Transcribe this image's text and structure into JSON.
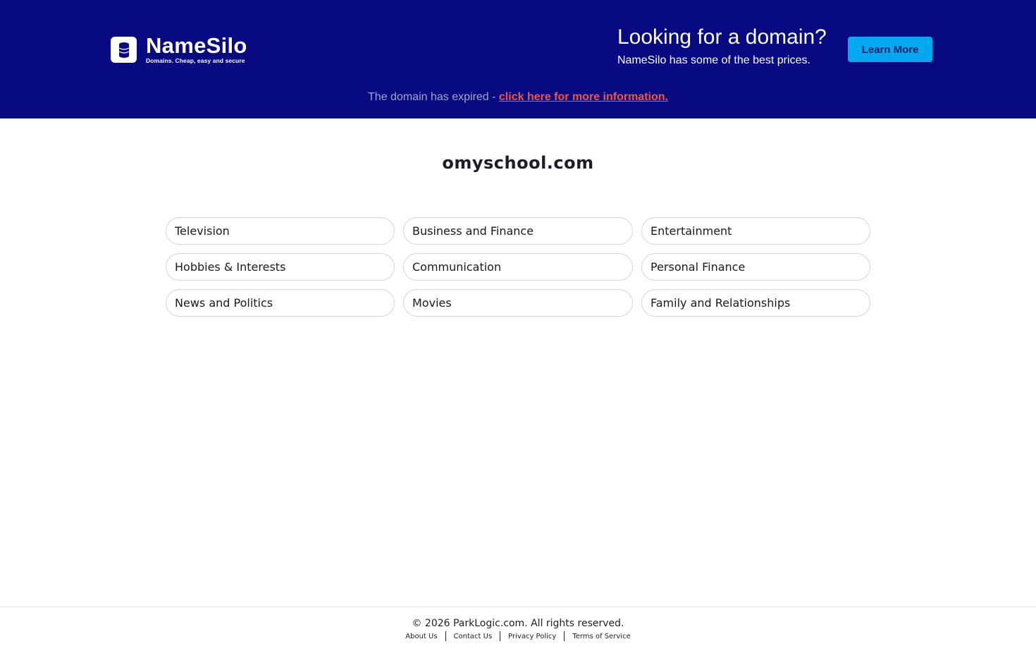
{
  "header": {
    "logo": {
      "name": "NameSilo",
      "tagline": "Domains. Cheap, easy and secure",
      "icon": "database-icon"
    },
    "promo": {
      "title": "Looking for a domain?",
      "subtitle": "NameSilo has some of the best prices."
    },
    "learn_more_label": "Learn More",
    "expired_text": "The domain has expired - ",
    "expired_link": "click here for more information."
  },
  "main": {
    "domain": "omyschool.com",
    "categories": [
      "Television",
      "Business and Finance",
      "Entertainment",
      "Hobbies & Interests",
      "Communication",
      "Personal Finance",
      "News and Politics",
      "Movies",
      "Family and Relationships"
    ]
  },
  "footer": {
    "copyright": "© 2026 ParkLogic.com. All rights reserved.",
    "links": [
      "About Us",
      "Contact Us",
      "Privacy Policy",
      "Terms of Service"
    ]
  },
  "colors": {
    "header_bg": "#070a80",
    "button_bg": "#03a9f0",
    "link_red": "#f25546"
  }
}
